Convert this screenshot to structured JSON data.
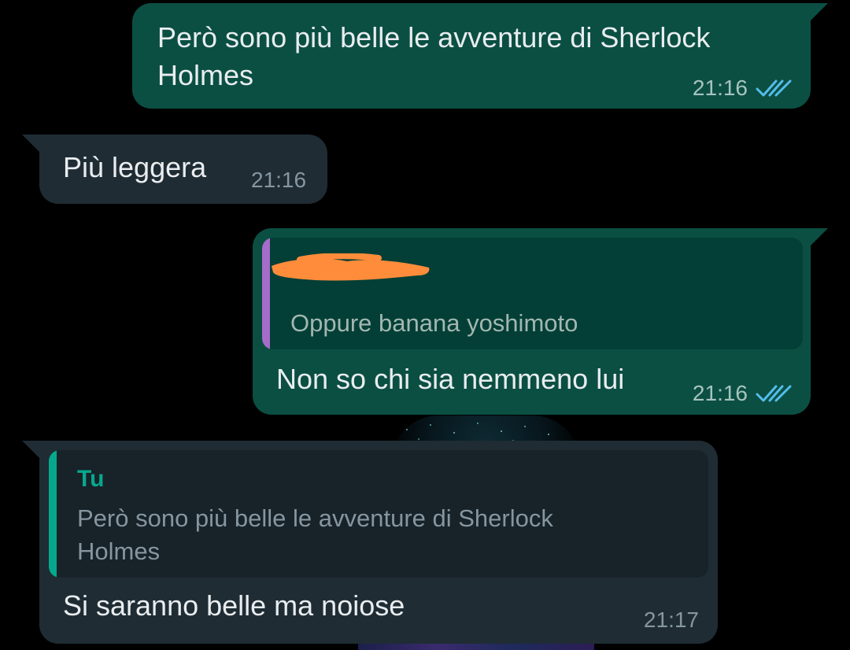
{
  "messages": [
    {
      "id": "m1",
      "direction": "outgoing",
      "text": "Però sono più belle le avventure di Sherlock\nHolmes",
      "time": "21:16",
      "status": "read"
    },
    {
      "id": "m2",
      "direction": "incoming",
      "text": "Più leggera",
      "time": "21:16"
    },
    {
      "id": "m3",
      "direction": "outgoing",
      "reply_to": {
        "author": "",
        "author_redacted": true,
        "text": "Oppure banana yoshimoto"
      },
      "text": "Non so chi sia nemmeno lui",
      "time": "21:16",
      "status": "read"
    },
    {
      "id": "m4",
      "direction": "incoming",
      "reply_to": {
        "author": "Tu",
        "text": "Però sono più belle le avventure di Sherlock\nHolmes"
      },
      "text": "Si saranno belle ma noiose",
      "time": "21:17"
    }
  ],
  "colors": {
    "background": "#000000",
    "outgoing_bubble": "#0b4f43",
    "incoming_bubble": "#1f2c34",
    "read_ticks": "#53bdeb",
    "quote_bar_contact": "#a66cc9",
    "quote_bar_self": "#06a88c",
    "quote_author_self": "#06a88c",
    "redaction_mark": "#ff8c3a"
  },
  "icons": {
    "read_receipt": "double-check-icon"
  }
}
